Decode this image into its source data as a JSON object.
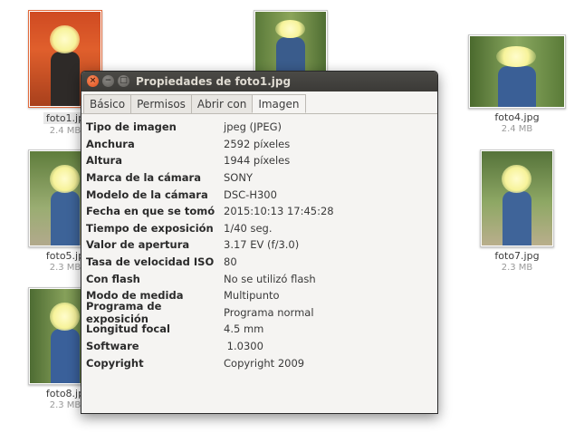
{
  "files": [
    {
      "name": "foto1.jp",
      "size": "2.4 MB",
      "selected": true
    },
    {
      "name": "foto4.jpg",
      "size": "2.4 MB"
    },
    {
      "name": "foto5.jp",
      "size": "2.3 MB"
    },
    {
      "name": "foto7.jpg",
      "size": "2.3 MB"
    },
    {
      "name": "foto8.jp",
      "size": "2.3 MB"
    }
  ],
  "dialog": {
    "title": "Propiedades de foto1.jpg",
    "buttons": {
      "close": "×",
      "minimize": "−",
      "maximize": "□"
    },
    "tabs": [
      "Básico",
      "Permisos",
      "Abrir con",
      "Imagen"
    ],
    "active_tab": "Imagen",
    "properties": [
      {
        "label": "Tipo de imagen",
        "value": "jpeg (JPEG)"
      },
      {
        "label": "Anchura",
        "value": "2592 píxeles"
      },
      {
        "label": "Altura",
        "value": "1944 píxeles"
      },
      {
        "label": "Marca de la cámara",
        "value": "SONY"
      },
      {
        "label": "Modelo de la cámara",
        "value": "DSC-H300"
      },
      {
        "label": "Fecha en que se tomó",
        "value": "2015:10:13 17:45:28"
      },
      {
        "label": "Tiempo de exposición",
        "value": "1/40 seg."
      },
      {
        "label": "Valor de apertura",
        "value": "3.17 EV (f/3.0)"
      },
      {
        "label": "Tasa de velocidad ISO",
        "value": "80"
      },
      {
        "label": "Con flash",
        "value": "No se utilizó flash"
      },
      {
        "label": "Modo de medida",
        "value": "Multipunto"
      },
      {
        "label": "Programa de exposición",
        "value": "Programa normal"
      },
      {
        "label": "Longitud focal",
        "value": "4.5 mm"
      },
      {
        "label": "Software",
        "value": " 1.0300"
      },
      {
        "label": "Copyright",
        "value": "Copyright 2009"
      }
    ]
  }
}
